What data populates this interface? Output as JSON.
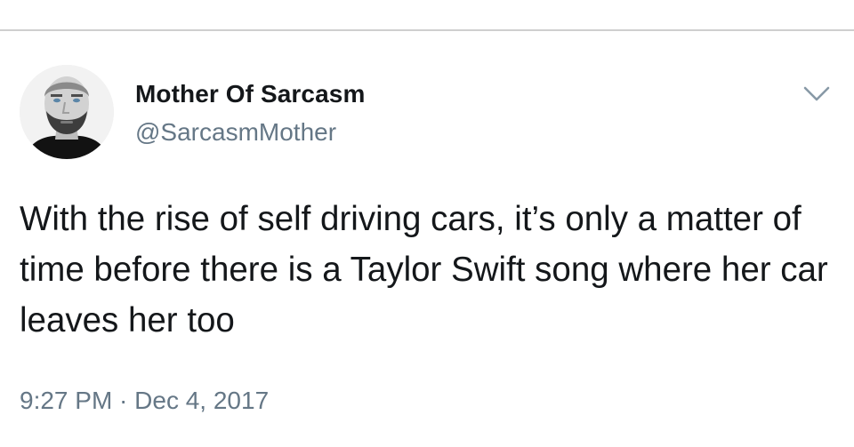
{
  "tweet": {
    "author": {
      "display_name": "Mother Of Sarcasm",
      "handle": "@SarcasmMother",
      "avatar_icon": "profile-photo"
    },
    "text": "With the rise of self driving cars, it’s only a matter of time before there is a Taylor Swift song where her car leaves her too",
    "timestamp": "9:27 PM · Dec 4, 2017",
    "menu_icon": "chevron-down-icon"
  },
  "colors": {
    "text_primary": "#14171a",
    "text_secondary": "#657786",
    "divider": "#cfcfcf",
    "background": "#ffffff"
  }
}
